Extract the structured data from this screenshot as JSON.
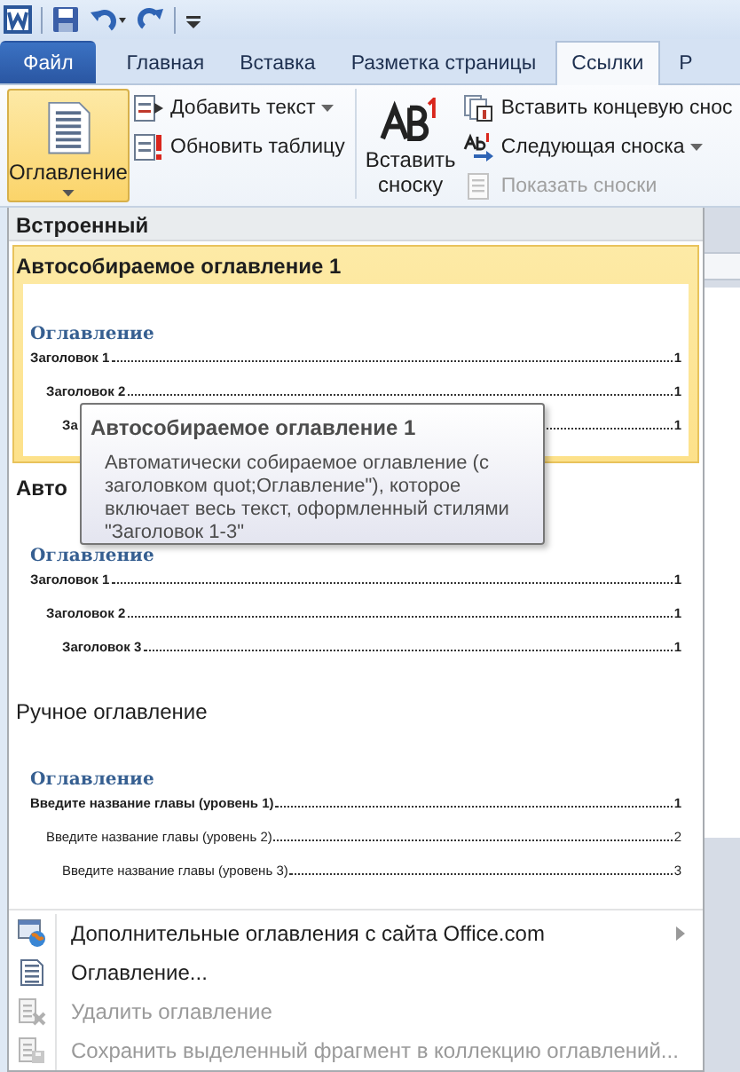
{
  "tabs": [
    {
      "label": "Файл",
      "kind": "file",
      "selected": false
    },
    {
      "label": "Главная",
      "kind": "tab",
      "selected": false
    },
    {
      "label": "Вставка",
      "kind": "tab",
      "selected": false
    },
    {
      "label": "Разметка страницы",
      "kind": "tab",
      "selected": false
    },
    {
      "label": "Ссылки",
      "kind": "tab",
      "selected": true
    },
    {
      "label": "Р",
      "kind": "tab",
      "selected": false
    }
  ],
  "ribbon": {
    "toc_button": {
      "label": "Оглавление",
      "pressed": true
    },
    "toc_commands": [
      {
        "label": "Добавить текст",
        "kind": "add-text",
        "dropdown": true
      },
      {
        "label": "Обновить таблицу",
        "kind": "update",
        "dropdown": false
      }
    ],
    "footnote_button": {
      "label": "Вставить сноску"
    },
    "footnote_commands": [
      {
        "label": "Вставить концевую снос",
        "kind": "endnote",
        "dropdown": false,
        "disabled": false
      },
      {
        "label": "Следующая сноска",
        "kind": "next",
        "dropdown": true,
        "disabled": false
      },
      {
        "label": "Показать сноски",
        "kind": "show",
        "dropdown": false,
        "disabled": true
      }
    ]
  },
  "menu": {
    "section_header": "Встроенный",
    "gallery": [
      {
        "title": "Автособираемое оглавление 1",
        "title_bold": true,
        "selected": true,
        "preview": {
          "heading": "Оглавление",
          "entries": [
            {
              "text": "Заголовок 1",
              "page": "1",
              "bold": true,
              "children": [
                {
                  "text": "Заголовок 2",
                  "page": "1",
                  "bold": true,
                  "children": [
                    {
                      "text": "За",
                      "page": "1",
                      "bold": true
                    }
                  ]
                }
              ]
            }
          ]
        }
      },
      {
        "title": "Авто",
        "title_bold": true,
        "selected": false,
        "preview": {
          "heading": "Оглавление",
          "entries": [
            {
              "text": "Заголовок 1",
              "page": "1",
              "bold": true,
              "children": [
                {
                  "text": "Заголовок 2",
                  "page": "1",
                  "bold": true,
                  "children": [
                    {
                      "text": "Заголовок 3",
                      "page": "1",
                      "bold": true
                    }
                  ]
                }
              ]
            }
          ]
        }
      },
      {
        "title": "Ручное оглавление",
        "title_bold": false,
        "selected": false,
        "preview": {
          "heading": "Оглавление",
          "entries": [
            {
              "text": "Введите название главы (уровень 1)",
              "page": "1",
              "bold": true,
              "children": [
                {
                  "text": "Введите название главы (уровень 2)",
                  "page": "2",
                  "bold": false,
                  "children": [
                    {
                      "text": "Введите название главы (уровень 3)",
                      "page": "3",
                      "bold": false
                    }
                  ]
                }
              ]
            }
          ]
        }
      }
    ],
    "commands": [
      {
        "label": "Дополнительные оглавления с сайта Office.com",
        "kind": "web",
        "disabled": false,
        "submenu": true
      },
      {
        "label": "Оглавление...",
        "kind": "dialog",
        "disabled": false,
        "submenu": false
      },
      {
        "label": "Удалить оглавление",
        "kind": "remove",
        "disabled": true,
        "submenu": false
      },
      {
        "label": "Сохранить выделенный фрагмент в коллекцию оглавлений...",
        "kind": "save",
        "disabled": true,
        "submenu": false
      }
    ]
  },
  "tooltip": {
    "title": "Автособираемое оглавление 1",
    "text": "Автоматически собираемое оглавление (с заголовком quot;Оглавление\"), которое включает весь текст, оформленный стилями \"Заголовок 1-3\""
  }
}
